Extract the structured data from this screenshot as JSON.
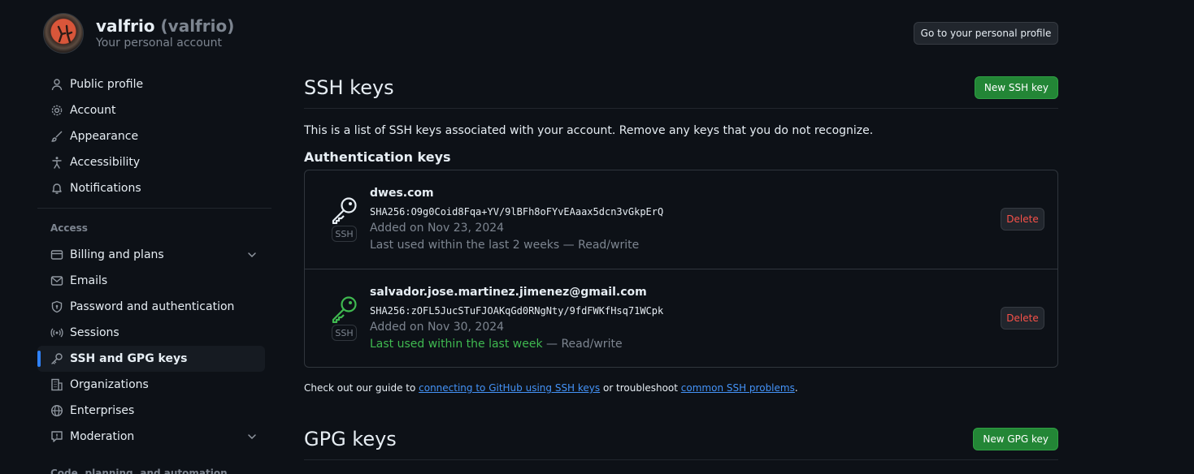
{
  "header": {
    "name": "valfrio",
    "login": "(valfrio)",
    "subtitle": "Your personal account",
    "profile_button": "Go to your personal profile"
  },
  "sidebar": {
    "items": [
      {
        "label": "Public profile",
        "icon": "person-icon"
      },
      {
        "label": "Account",
        "icon": "gear-icon"
      },
      {
        "label": "Appearance",
        "icon": "paintbrush-icon"
      },
      {
        "label": "Accessibility",
        "icon": "accessibility-icon"
      },
      {
        "label": "Notifications",
        "icon": "bell-icon"
      }
    ],
    "access_heading": "Access",
    "access_items": [
      {
        "label": "Billing and plans",
        "icon": "credit-card-icon"
      },
      {
        "label": "Emails",
        "icon": "mail-icon"
      },
      {
        "label": "Password and authentication",
        "icon": "shield-lock-icon"
      },
      {
        "label": "Sessions",
        "icon": "broadcast-icon"
      },
      {
        "label": "SSH and GPG keys",
        "icon": "key-icon",
        "active": true
      },
      {
        "label": "Organizations",
        "icon": "organization-icon"
      },
      {
        "label": "Enterprises",
        "icon": "globe-icon"
      },
      {
        "label": "Moderation",
        "icon": "report-icon"
      }
    ],
    "cut_heading": "Code, planning, and automation"
  },
  "ssh": {
    "title": "SSH keys",
    "new_button": "New SSH key",
    "description": "This is a list of SSH keys associated with your account. Remove any keys that you do not recognize.",
    "auth_title": "Authentication keys",
    "keys": [
      {
        "title": "dwes.com",
        "fingerprint": "SHA256:O9g0Coid8Fqa+YV/9lBFh8oFYvEAaax5dcn3vGkpErQ",
        "added": "Added on Nov 23, 2024",
        "used": "Last used within the last 2 weeks",
        "access": " — Read/write",
        "type": "SSH",
        "delete": "Delete",
        "icon_color": "#e6edf3"
      },
      {
        "title": "salvador.jose.martinez.jimenez@gmail.com",
        "fingerprint": "SHA256:zOFL5JucSTuFJOAKqGd0RNgNty/9fdFWKfHsq71WCpk",
        "added": "Added on Nov 30, 2024",
        "used": "Last used within the last week",
        "access": " — Read/write",
        "type": "SSH",
        "delete": "Delete",
        "icon_color": "#3fb950"
      }
    ],
    "guide_prefix": "Check out our guide to ",
    "guide_link1": "connecting to GitHub using SSH keys",
    "guide_mid": " or troubleshoot ",
    "guide_link2": "common SSH problems",
    "guide_suffix": "."
  },
  "gpg": {
    "title": "GPG keys",
    "new_button": "New GPG key"
  }
}
